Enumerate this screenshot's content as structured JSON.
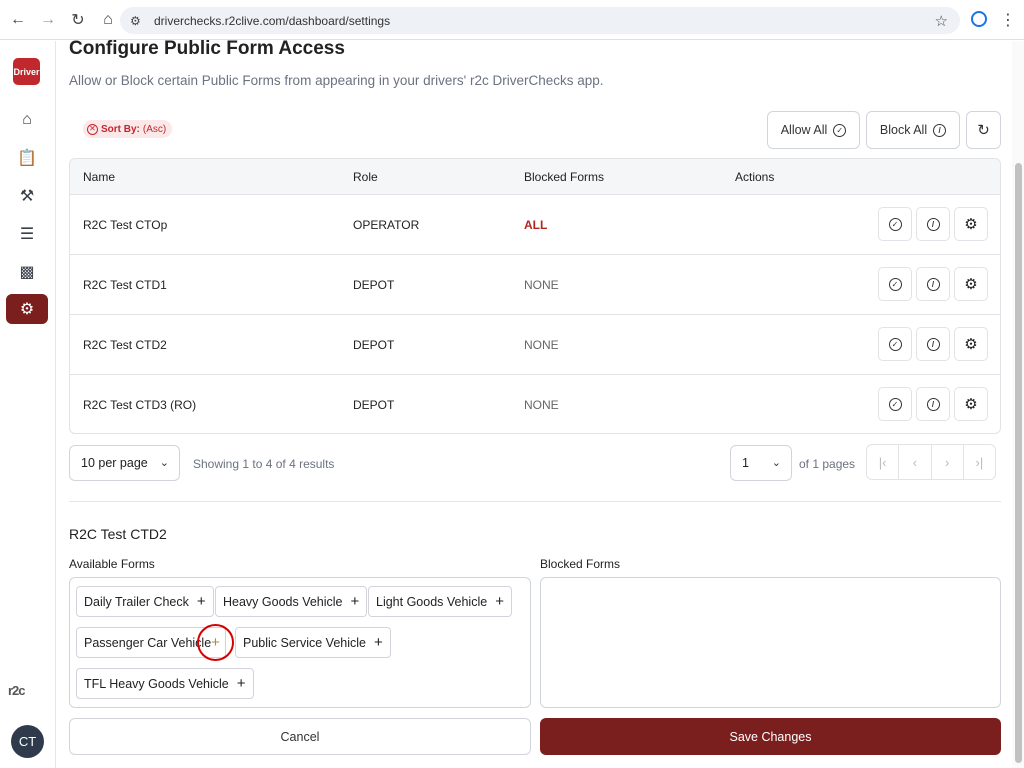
{
  "browser": {
    "url": "driverchecks.r2clive.com/dashboard/settings"
  },
  "sidebar": {
    "logo_text": "Driver",
    "brand": "r2c",
    "avatar_initials": "CT",
    "items": [
      {
        "icon": "home-icon"
      },
      {
        "icon": "clipboard-icon"
      },
      {
        "icon": "tools-icon"
      },
      {
        "icon": "list-icon"
      },
      {
        "icon": "chart-icon"
      },
      {
        "icon": "settings-icon",
        "active": true
      }
    ]
  },
  "header": {
    "title": "Configure Public Form Access",
    "subtitle": "Allow or Block certain Public Forms from appearing in your drivers' r2c DriverChecks app."
  },
  "toolbar": {
    "sort_label": "Sort By:",
    "sort_value": "(Asc)",
    "allow_all_label": "Allow All",
    "block_all_label": "Block All"
  },
  "table": {
    "columns": [
      "Name",
      "Role",
      "Blocked Forms",
      "Actions"
    ],
    "rows": [
      {
        "name": "R2C Test CTOp",
        "role": "OPERATOR",
        "blocked": "ALL"
      },
      {
        "name": "R2C Test CTD1",
        "role": "DEPOT",
        "blocked": "NONE"
      },
      {
        "name": "R2C Test CTD2",
        "role": "DEPOT",
        "blocked": "NONE"
      },
      {
        "name": "R2C Test CTD3 (RO)",
        "role": "DEPOT",
        "blocked": "NONE"
      }
    ]
  },
  "pagination": {
    "per_page": "10 per page",
    "showing": "Showing 1 to 4 of 4 results",
    "page": "1",
    "of_pages": "of 1 pages"
  },
  "editor": {
    "selected_name": "R2C Test CTD2",
    "available_label": "Available Forms",
    "blocked_label": "Blocked Forms",
    "available_forms": [
      "Daily Trailer Check",
      "Heavy Goods Vehicle",
      "Light Goods Vehicle",
      "Passenger Car Vehicle",
      "Public Service Vehicle",
      "TFL Heavy Goods Vehicle"
    ],
    "blocked_forms": []
  },
  "footer": {
    "cancel_label": "Cancel",
    "save_label": "Save Changes"
  },
  "colors": {
    "accent": "#7a1e1e",
    "danger": "#b3261e",
    "brand_red": "#c0282d"
  }
}
